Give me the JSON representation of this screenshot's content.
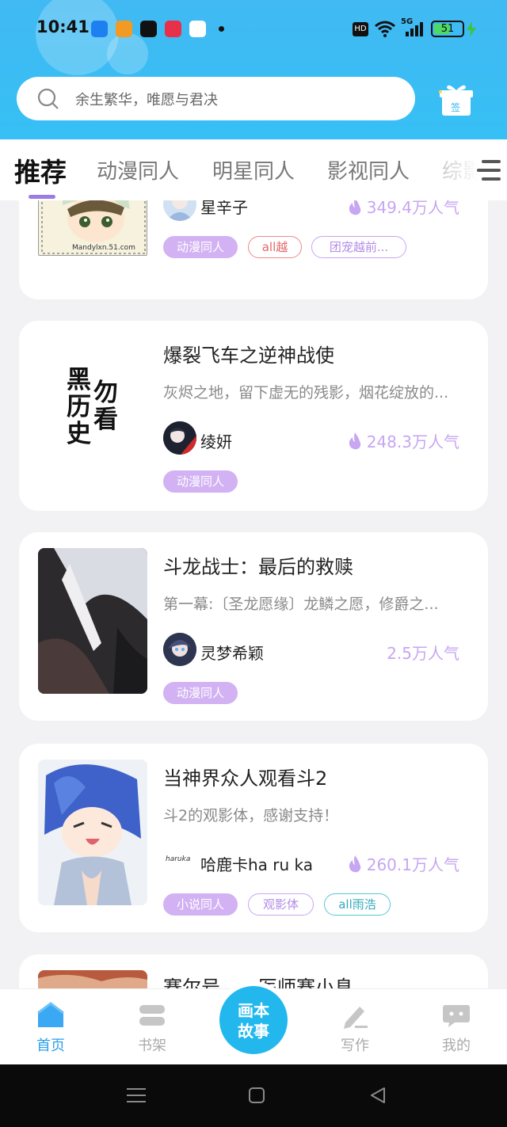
{
  "status_bar": {
    "time": "10:41",
    "battery": "51",
    "network": "5G",
    "hd_badge": "HD"
  },
  "search": {
    "placeholder": "余生繁华，唯愿与君决",
    "signin_badge": "签"
  },
  "tabs": [
    {
      "label": "推荐"
    },
    {
      "label": "动漫同人"
    },
    {
      "label": "明星同人"
    },
    {
      "label": "影视同人"
    },
    {
      "label": "综影"
    }
  ],
  "stories": [
    {
      "author": "星辛子",
      "popularity": "349.4万人气",
      "tags": [
        "动漫同人",
        "all越",
        "团宠越前..."
      ],
      "cover_caption": "Mandylxn.51.com"
    },
    {
      "title": "爆裂飞车之逆神战使",
      "description": "灰烬之地，留下虚无的残影，烟花绽放的...",
      "author": "绫妍",
      "popularity": "248.3万人气",
      "tags": [
        "动漫同人"
      ],
      "cover_text": [
        "黑",
        "历",
        "史",
        "勿",
        "看"
      ]
    },
    {
      "title": "斗龙战士：最后的救赎",
      "description": "第一幕:〔圣龙愿缘〕龙鳞之愿，修爵之...",
      "author": "灵梦希颖",
      "popularity": "2.5万人气",
      "tags": [
        "动漫同人"
      ]
    },
    {
      "title": "当神界众人观看斗2",
      "description": "斗2的观影体，感谢支持！",
      "author": "哈鹿卡ha ru ka",
      "author_logo": "haruka",
      "popularity": "260.1万人气",
      "tags": [
        "小说同人",
        "观影体",
        "all雨浩"
      ]
    },
    {
      "title": "赛尔号……医师赛小息"
    }
  ],
  "bottom_nav": {
    "home": "首页",
    "bookshelf": "书架",
    "center": "画本故事",
    "center_line1": "画本",
    "center_line2": "故事",
    "write": "写作",
    "mine": "我的"
  },
  "colors": {
    "header_blue": "#3dbbf3",
    "accent_purple": "#9b7be6",
    "tag_fill": "#d2b2f3",
    "popularity": "#c7a6f2",
    "center_button": "#22b8ee"
  }
}
